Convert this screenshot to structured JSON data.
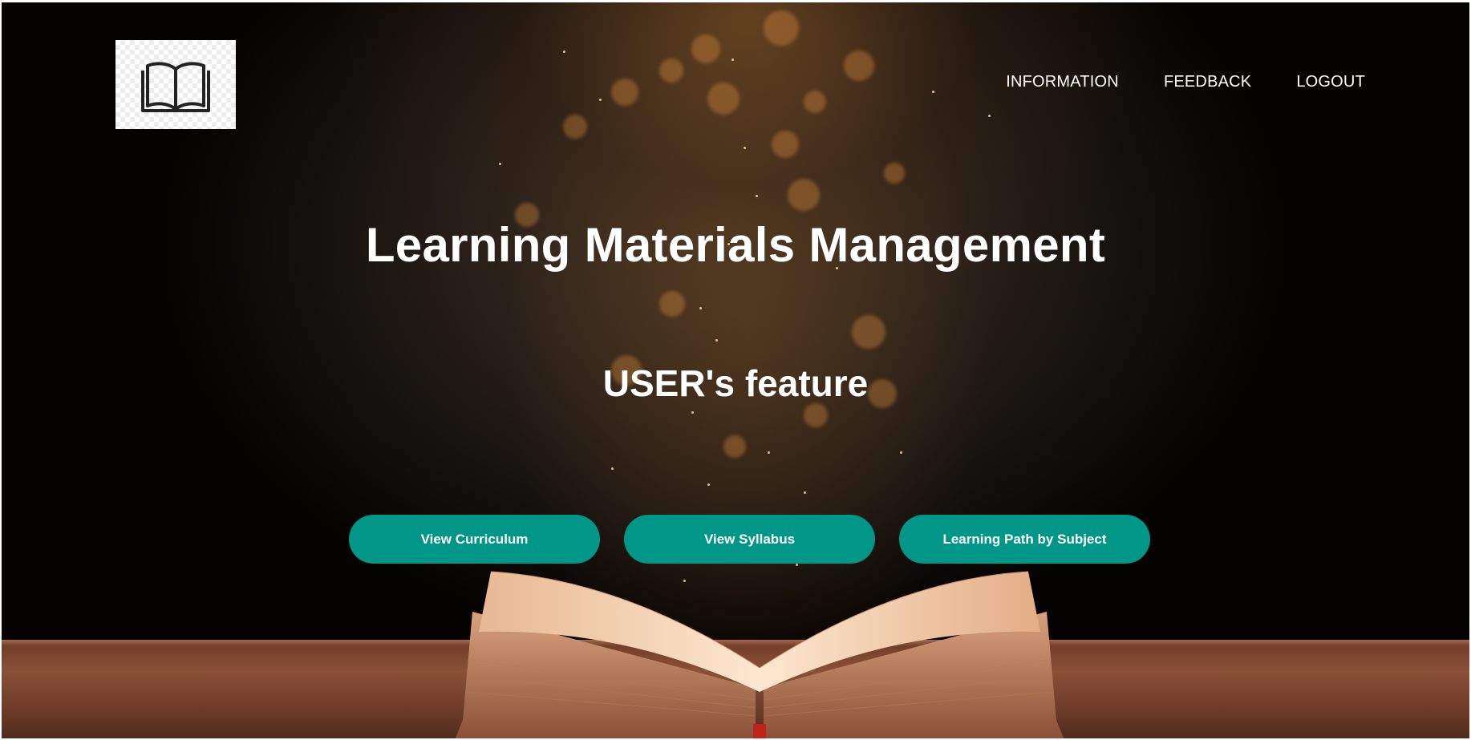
{
  "header": {
    "logo_icon": "open-book-icon",
    "nav": {
      "information": "INFORMATION",
      "feedback": "FEEDBACK",
      "logout": "LOGOUT"
    }
  },
  "hero": {
    "title": "Learning Materials Management",
    "subtitle": "USER's feature"
  },
  "actions": {
    "view_curriculum": "View Curriculum",
    "view_syllabus": "View Syllabus",
    "learning_path": "Learning Path by Subject"
  },
  "colors": {
    "button": "#009688",
    "text": "#ffffff"
  }
}
